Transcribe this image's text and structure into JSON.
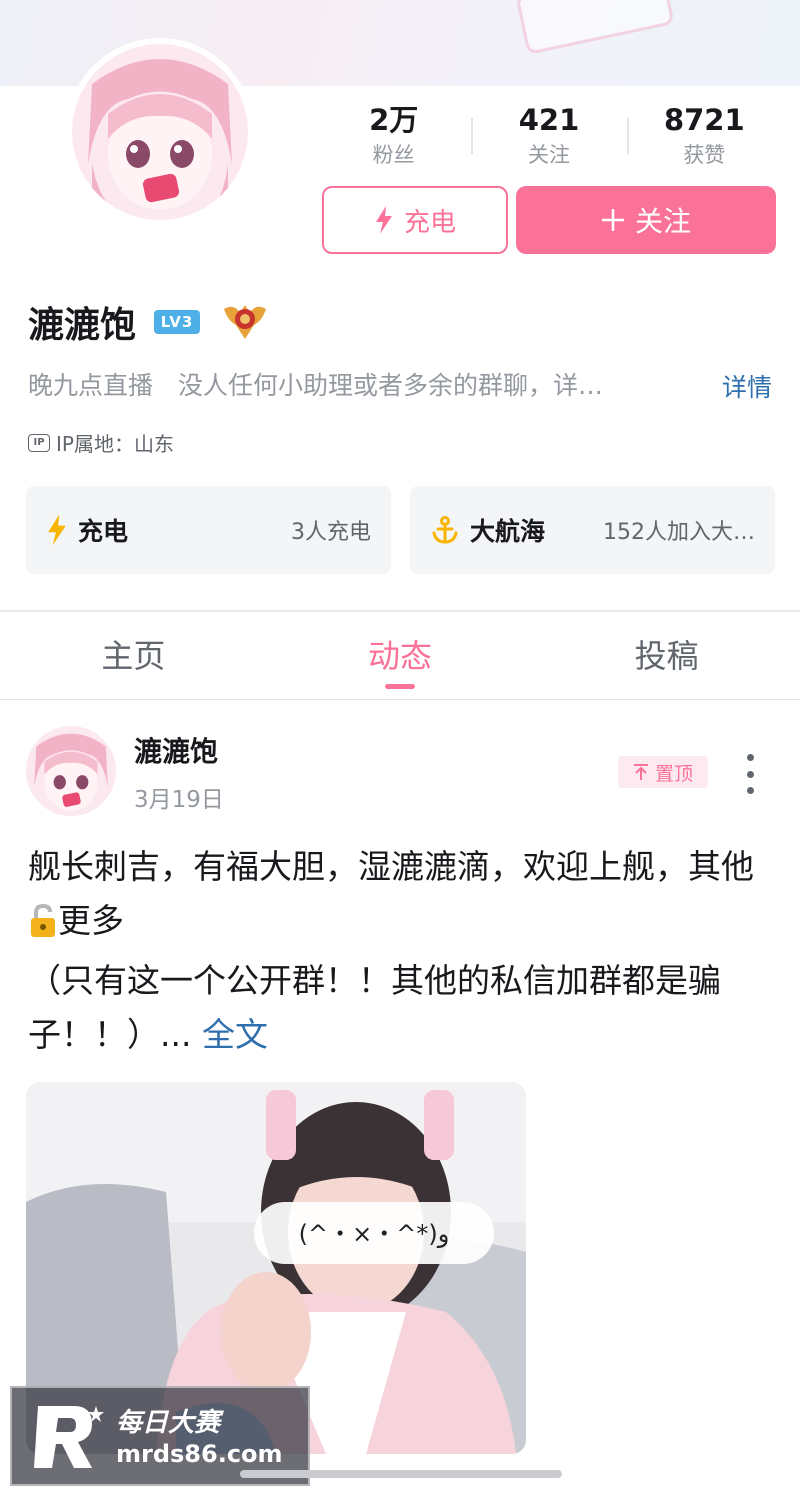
{
  "profile": {
    "name": "漉漉饱",
    "level": "LV3",
    "bio": "晚九点直播　没人任何小助理或者多余的群聊，详…",
    "bio_more": "详情",
    "ip": "IP属地：山东",
    "ip_badge": "IP"
  },
  "stats": [
    {
      "value": "2万",
      "label": "粉丝"
    },
    {
      "value": "421",
      "label": "关注"
    },
    {
      "value": "8721",
      "label": "获赞"
    }
  ],
  "buttons": {
    "charge": "充电",
    "follow": "关注"
  },
  "cards": {
    "charge": {
      "title": "充电",
      "info": "3人充电"
    },
    "voyage": {
      "title": "大航海",
      "info": "152人加入大…"
    }
  },
  "tabs": [
    "主页",
    "动态",
    "投稿"
  ],
  "active_tab": 1,
  "post": {
    "author": "漉漉饱",
    "date": "3月19日",
    "pinned": "置顶",
    "text_1": "舰长刺吉，有福大胆，湿漉漉滴，欢迎上舰，其他",
    "text_2": "更多",
    "text_3": "（只有这一个公开群！！其他的私信加群都是骗子！！）...",
    "full_text": "全文",
    "photo_caption": "(^・×・^*)و"
  },
  "watermark": {
    "brand": "每日大赛",
    "url": "mrds86.com"
  },
  "colors": {
    "accent": "#fb7299",
    "link": "#2f6fae",
    "level_badge": "#4fb0e8"
  }
}
